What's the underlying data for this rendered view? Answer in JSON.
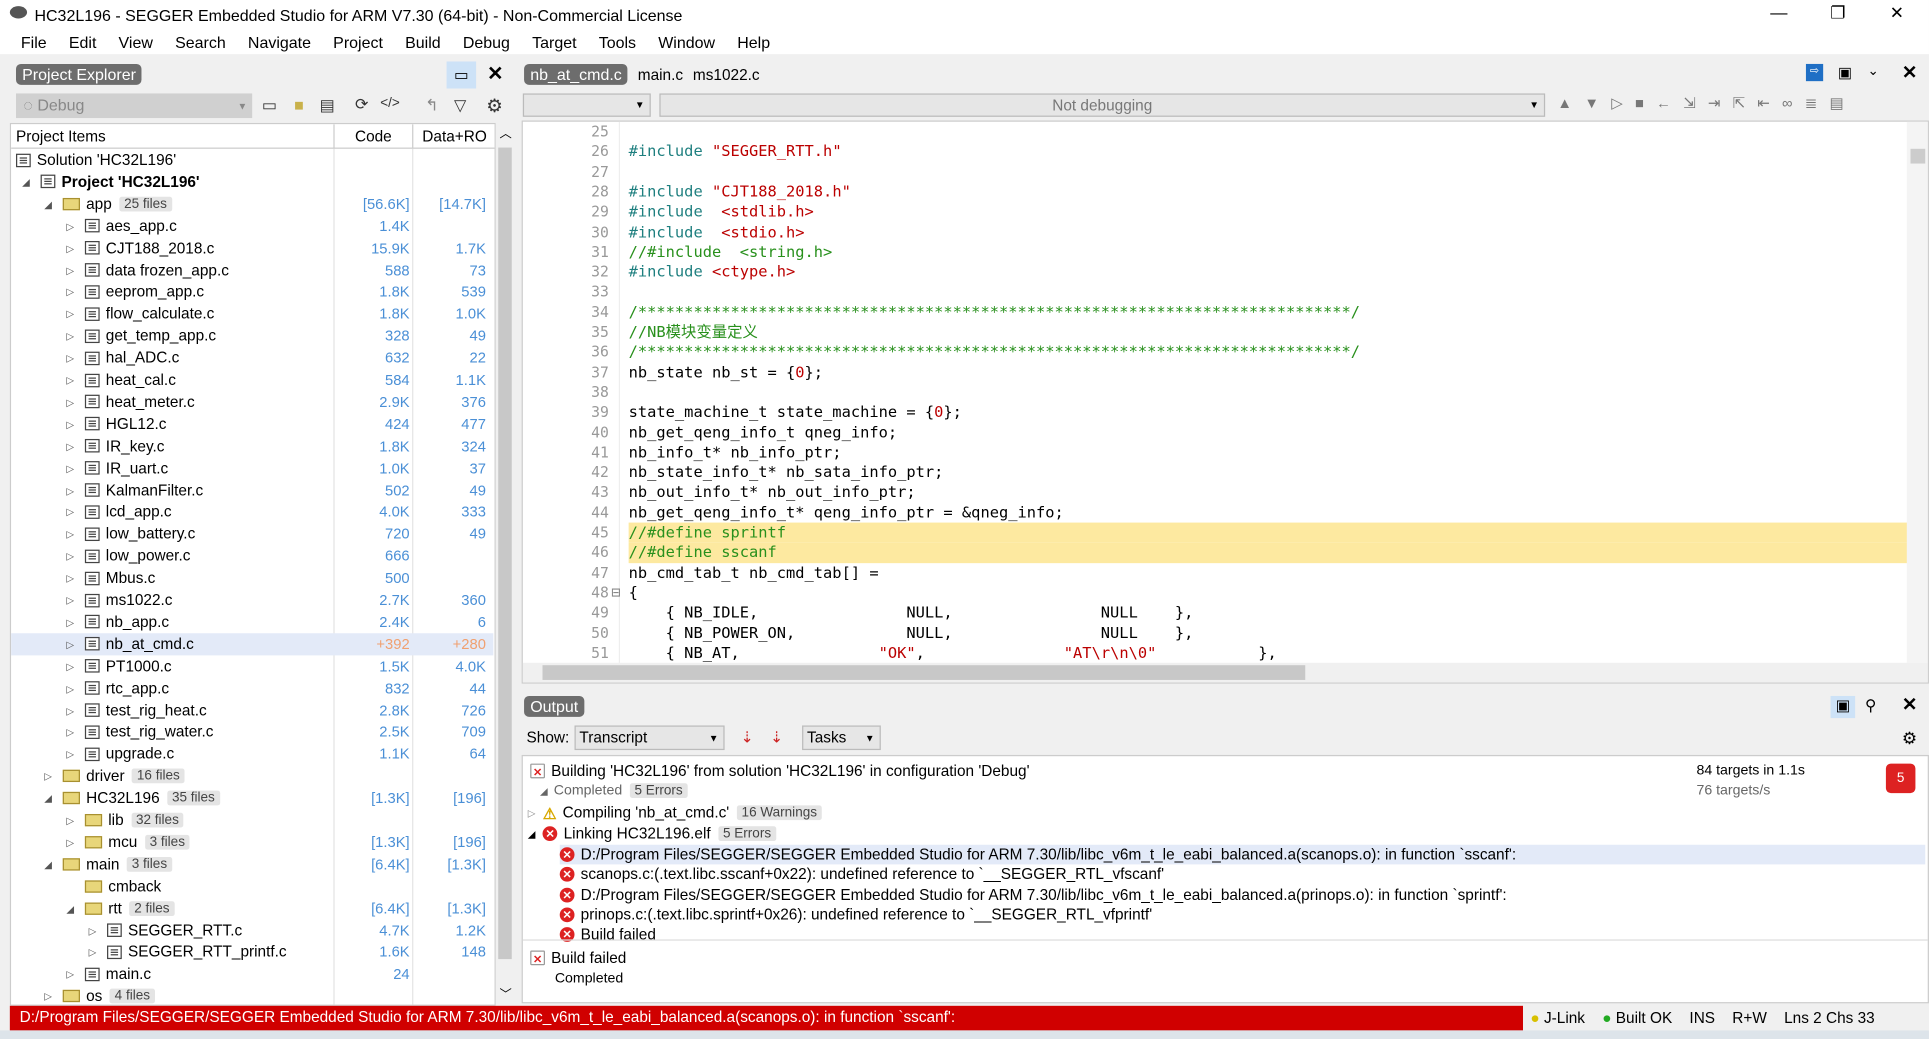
{
  "window": {
    "title": "HC32L196 - SEGGER Embedded Studio for ARM V7.30 (64-bit) - Non-Commercial License",
    "minimize": "—",
    "restore": "❐",
    "close": "✕"
  },
  "menu": [
    "File",
    "Edit",
    "View",
    "Search",
    "Navigate",
    "Project",
    "Build",
    "Debug",
    "Target",
    "Tools",
    "Window",
    "Help"
  ],
  "project_explorer": {
    "title": "Project Explorer",
    "config": "Debug",
    "columns": {
      "name": "Project Items",
      "code": "Code",
      "data": "Data+RO"
    },
    "rows": [
      {
        "lvl": 0,
        "type": "sol",
        "name": "Solution 'HC32L196'"
      },
      {
        "lvl": 0,
        "type": "proj",
        "name": "Project 'HC32L196'",
        "open": true,
        "bold": true
      },
      {
        "lvl": 1,
        "type": "folder",
        "name": "app",
        "badge": "25 files",
        "code": "[56.6K]",
        "data": "[14.7K]",
        "open": true
      },
      {
        "lvl": 2,
        "type": "file",
        "name": "aes_app.c",
        "code": "1.4K",
        "data": ""
      },
      {
        "lvl": 2,
        "type": "file",
        "name": "CJT188_2018.c",
        "code": "15.9K",
        "data": "1.7K"
      },
      {
        "lvl": 2,
        "type": "file",
        "name": "data frozen_app.c",
        "code": "588",
        "data": "73"
      },
      {
        "lvl": 2,
        "type": "file",
        "name": "eeprom_app.c",
        "code": "1.8K",
        "data": "539"
      },
      {
        "lvl": 2,
        "type": "file",
        "name": "flow_calculate.c",
        "code": "1.8K",
        "data": "1.0K"
      },
      {
        "lvl": 2,
        "type": "file",
        "name": "get_temp_app.c",
        "code": "328",
        "data": "49"
      },
      {
        "lvl": 2,
        "type": "file",
        "name": "hal_ADC.c",
        "code": "632",
        "data": "22"
      },
      {
        "lvl": 2,
        "type": "file",
        "name": "heat_cal.c",
        "code": "584",
        "data": "1.1K"
      },
      {
        "lvl": 2,
        "type": "file",
        "name": "heat_meter.c",
        "code": "2.9K",
        "data": "376"
      },
      {
        "lvl": 2,
        "type": "file",
        "name": "HGL12.c",
        "code": "424",
        "data": "477"
      },
      {
        "lvl": 2,
        "type": "file",
        "name": "IR_key.c",
        "code": "1.8K",
        "data": "324"
      },
      {
        "lvl": 2,
        "type": "file",
        "name": "IR_uart.c",
        "code": "1.0K",
        "data": "37"
      },
      {
        "lvl": 2,
        "type": "file",
        "name": "KalmanFilter.c",
        "code": "502",
        "data": "49"
      },
      {
        "lvl": 2,
        "type": "file",
        "name": "lcd_app.c",
        "code": "4.0K",
        "data": "333"
      },
      {
        "lvl": 2,
        "type": "file",
        "name": "low_battery.c",
        "code": "720",
        "data": "49"
      },
      {
        "lvl": 2,
        "type": "file",
        "name": "low_power.c",
        "code": "666",
        "data": ""
      },
      {
        "lvl": 2,
        "type": "file",
        "name": "Mbus.c",
        "code": "500",
        "data": ""
      },
      {
        "lvl": 2,
        "type": "file",
        "name": "ms1022.c",
        "code": "2.7K",
        "data": "360"
      },
      {
        "lvl": 2,
        "type": "file",
        "name": "nb_app.c",
        "code": "2.4K",
        "data": "6"
      },
      {
        "lvl": 2,
        "type": "file",
        "name": "nb_at_cmd.c",
        "code": "+392",
        "data": "+280",
        "selected": true,
        "changed": true
      },
      {
        "lvl": 2,
        "type": "file",
        "name": "PT1000.c",
        "code": "1.5K",
        "data": "4.0K"
      },
      {
        "lvl": 2,
        "type": "file",
        "name": "rtc_app.c",
        "code": "832",
        "data": "44"
      },
      {
        "lvl": 2,
        "type": "file",
        "name": "test_rig_heat.c",
        "code": "2.8K",
        "data": "726"
      },
      {
        "lvl": 2,
        "type": "file",
        "name": "test_rig_water.c",
        "code": "2.5K",
        "data": "709"
      },
      {
        "lvl": 2,
        "type": "file",
        "name": "upgrade.c",
        "code": "1.1K",
        "data": "64"
      },
      {
        "lvl": 1,
        "type": "folder",
        "name": "driver",
        "badge": "16 files",
        "code": "",
        "data": ""
      },
      {
        "lvl": 1,
        "type": "folder",
        "name": "HC32L196",
        "badge": "35 files",
        "code": "[1.3K]",
        "data": "[196]",
        "open": true
      },
      {
        "lvl": 2,
        "type": "folder",
        "name": "lib",
        "badge": "32 files",
        "code": "",
        "data": ""
      },
      {
        "lvl": 2,
        "type": "folder",
        "name": "mcu",
        "badge": "3 files",
        "code": "[1.3K]",
        "data": "[196]"
      },
      {
        "lvl": 1,
        "type": "folder",
        "name": "main",
        "badge": "3 files",
        "code": "[6.4K]",
        "data": "[1.3K]",
        "open": true
      },
      {
        "lvl": 2,
        "type": "folder",
        "name": "cmback",
        "noexp": true,
        "code": "",
        "data": ""
      },
      {
        "lvl": 2,
        "type": "folder",
        "name": "rtt",
        "badge": "2 files",
        "code": "[6.4K]",
        "data": "[1.3K]",
        "open": true
      },
      {
        "lvl": 3,
        "type": "file",
        "name": "SEGGER_RTT.c",
        "code": "4.7K",
        "data": "1.2K"
      },
      {
        "lvl": 3,
        "type": "file",
        "name": "SEGGER_RTT_printf.c",
        "code": "1.6K",
        "data": "148"
      },
      {
        "lvl": 2,
        "type": "file",
        "name": "main.c",
        "code": "24",
        "data": ""
      },
      {
        "lvl": 1,
        "type": "folder",
        "name": "os",
        "badge": "4 files",
        "code": "",
        "data": ""
      }
    ]
  },
  "editor": {
    "tabs": [
      "nb_at_cmd.c",
      "main.c",
      "ms1022.c"
    ],
    "active_tab": "nb_at_cmd.c",
    "debug_status": "Not debugging",
    "highlight_lines": [
      45,
      46
    ],
    "lines": [
      {
        "n": "25",
        "t": []
      },
      {
        "n": "26",
        "t": [
          [
            "k",
            "#include "
          ],
          [
            "s",
            "\"SEGGER_RTT.h\""
          ]
        ]
      },
      {
        "n": "27",
        "t": []
      },
      {
        "n": "28",
        "t": [
          [
            "k",
            "#include "
          ],
          [
            "s",
            "\"CJT188_2018.h\""
          ]
        ]
      },
      {
        "n": "29",
        "t": [
          [
            "k",
            "#include  "
          ],
          [
            "s",
            "<stdlib.h>"
          ]
        ]
      },
      {
        "n": "30",
        "t": [
          [
            "k",
            "#include  "
          ],
          [
            "s",
            "<stdio.h>"
          ]
        ]
      },
      {
        "n": "31",
        "t": [
          [
            "c",
            "//#include  <string.h>"
          ]
        ]
      },
      {
        "n": "32",
        "t": [
          [
            "k",
            "#include "
          ],
          [
            "s",
            "<ctype.h>"
          ]
        ]
      },
      {
        "n": "33",
        "t": []
      },
      {
        "n": "34",
        "t": [
          [
            "c",
            "/*****************************************************************************/"
          ]
        ]
      },
      {
        "n": "35",
        "t": [
          [
            "c",
            "//NB模块变量定义"
          ]
        ]
      },
      {
        "n": "36",
        "t": [
          [
            "c",
            "/*****************************************************************************/"
          ]
        ]
      },
      {
        "n": "37",
        "t": [
          [
            "",
            "nb_state nb_st = {"
          ],
          [
            "s",
            "0"
          ],
          [
            "",
            "};"
          ]
        ]
      },
      {
        "n": "38",
        "t": []
      },
      {
        "n": "39",
        "t": [
          [
            "",
            "state_machine_t state_machine = {"
          ],
          [
            "s",
            "0"
          ],
          [
            "",
            "};"
          ]
        ]
      },
      {
        "n": "40",
        "t": [
          [
            "",
            "nb_get_qeng_info_t qneg_info;"
          ]
        ]
      },
      {
        "n": "41",
        "t": [
          [
            "",
            "nb_info_t* nb_info_ptr;"
          ]
        ]
      },
      {
        "n": "42",
        "t": [
          [
            "",
            "nb_state_info_t* nb_sata_info_ptr;"
          ]
        ]
      },
      {
        "n": "43",
        "t": [
          [
            "",
            "nb_out_info_t* nb_out_info_ptr;"
          ]
        ]
      },
      {
        "n": "44",
        "t": [
          [
            "",
            "nb_get_qeng_info_t* qeng_info_ptr = &qneg_info;"
          ]
        ]
      },
      {
        "n": "45",
        "t": [
          [
            "c",
            "//#define sprintf"
          ]
        ]
      },
      {
        "n": "46",
        "t": [
          [
            "c",
            "//#define sscanf"
          ]
        ]
      },
      {
        "n": "47",
        "t": [
          [
            "",
            "nb_cmd_tab_t nb_cmd_tab[] ="
          ]
        ]
      },
      {
        "n": "48",
        "t": [
          [
            "",
            "{"
          ]
        ]
      },
      {
        "n": "49",
        "t": [
          [
            "",
            "    { NB_IDLE,                NULL,                NULL    },"
          ]
        ]
      },
      {
        "n": "50",
        "t": [
          [
            "",
            "    { NB_POWER_ON,            NULL,                NULL    },"
          ]
        ]
      },
      {
        "n": "51",
        "t": [
          [
            "",
            "    { NB_AT,               "
          ],
          [
            "s",
            "\"OK\""
          ],
          [
            "",
            ",               "
          ],
          [
            "s",
            "\"AT\\r\\n\\0\""
          ],
          [
            "",
            "           },"
          ]
        ]
      }
    ]
  },
  "output": {
    "title": "Output",
    "show_label": "Show:",
    "show_value": "Transcript",
    "tasks_value": "Tasks",
    "build_title": "Building 'HC32L196' from solution 'HC32L196' in configuration 'Debug'",
    "completed": "Completed",
    "errors_badge": "5 Errors",
    "targets": "84 targets in 1.1s",
    "rate": "76 targets/s",
    "error_count": "5",
    "compiling": "Compiling 'nb_at_cmd.c'",
    "warnings_badge": "16 Warnings",
    "linking": "Linking HC32L196.elf",
    "link_errors_badge": "5 Errors",
    "errors": [
      "D:/Program Files/SEGGER/SEGGER Embedded Studio for ARM 7.30/lib/libc_v6m_t_le_eabi_balanced.a(scanops.o): in function `sscanf':",
      "scanops.c:(.text.libc.sscanf+0x22): undefined reference to `__SEGGER_RTL_vfscanf'",
      "D:/Program Files/SEGGER/SEGGER Embedded Studio for ARM 7.30/lib/libc_v6m_t_le_eabi_balanced.a(prinops.o): in function `sprintf':",
      "prinops.c:(.text.libc.sprintf+0x26): undefined reference to `__SEGGER_RTL_vfprintf'",
      "Build failed"
    ],
    "final_title": "Build failed",
    "final_status": "Completed"
  },
  "statusbar": {
    "message": "D:/Program Files/SEGGER/SEGGER Embedded Studio for ARM 7.30/lib/libc_v6m_t_le_eabi_balanced.a(scanops.o): in function `sscanf':",
    "jlink": "J-Link",
    "built": "Built OK",
    "ins": "INS",
    "rw": "R+W",
    "pos": "Lns 2 Chs 33"
  },
  "colors": {
    "accent": "#4a8fd6",
    "error_bar": "#d00000",
    "highlight": "#fde9a0",
    "selection": "#e3eaf8"
  }
}
